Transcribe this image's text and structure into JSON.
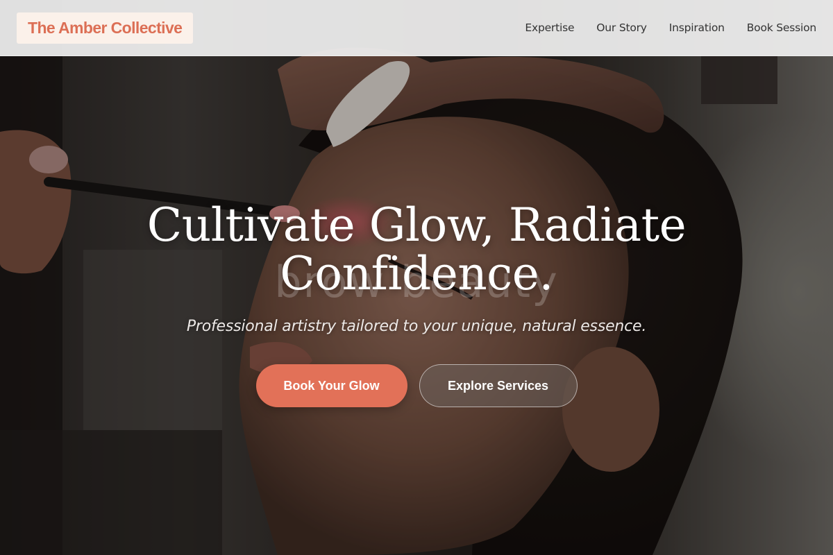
{
  "header": {
    "logo_text": "The Amber Collective",
    "nav": [
      {
        "label": "Expertise"
      },
      {
        "label": "Our Story"
      },
      {
        "label": "Inspiration"
      },
      {
        "label": "Book Session"
      }
    ]
  },
  "hero": {
    "headline_line1": "Cultivate Glow, Radiate",
    "headline_line2": "Confidence.",
    "background_word": "brow beauty",
    "tagline": "Professional artistry tailored to your unique, natural essence.",
    "primary_cta": "Book Your Glow",
    "secondary_cta": "Explore Services"
  },
  "colors": {
    "accent": "#e27158",
    "logo_text": "#dc6f55",
    "logo_bg": "#fbf1ea",
    "header_bg": "#f0f0f0"
  }
}
